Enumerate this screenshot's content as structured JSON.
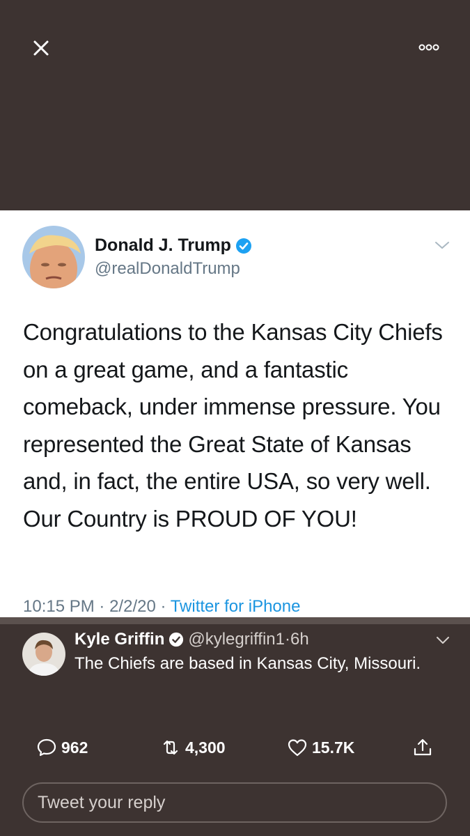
{
  "top_bar": {
    "close_icon": "close-icon",
    "more_icon": "more-options-icon"
  },
  "tweet": {
    "author_name": "Donald J. Trump",
    "author_handle": "@realDonaldTrump",
    "verified": true,
    "text": "Congratulations to the Kansas City Chiefs on a great game, and a fantastic comeback, under immense pressure. You represented the Great State of Kansas and, in fact, the entire USA, so very well. Our Country is PROUD OF YOU!",
    "time": "10:15 PM",
    "date": "2/2/20",
    "source": "Twitter for iPhone"
  },
  "reply_overlay": {
    "author_name": "Kyle Griffin",
    "author_handle": "@kylegriffin1",
    "age": "6h",
    "verified": true,
    "text": "The Chiefs are based in Kansas City, Missouri."
  },
  "actions": {
    "replies": "962",
    "retweets": "4,300",
    "likes": "15.7K"
  },
  "reply_input": {
    "placeholder": "Tweet your reply"
  },
  "colors": {
    "background": "#3d3331",
    "card": "#ffffff",
    "verified_blue": "#1da1f2",
    "link_blue": "#1b95e0",
    "muted": "#657786"
  }
}
